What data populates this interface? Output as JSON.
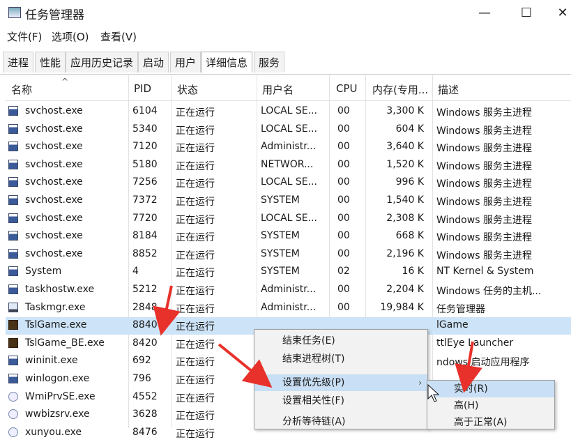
{
  "window": {
    "title": "任务管理器",
    "minimize_glyph": "—",
    "maximize_glyph": "☐",
    "close_glyph": "✕"
  },
  "menu": {
    "file": "文件(F)",
    "options": "选项(O)",
    "view": "查看(V)"
  },
  "tabs": [
    {
      "label": "进程"
    },
    {
      "label": "性能"
    },
    {
      "label": "应用历史记录"
    },
    {
      "label": "启动"
    },
    {
      "label": "用户"
    },
    {
      "label": "详细信息",
      "active": true
    },
    {
      "label": "服务"
    }
  ],
  "columns": {
    "name": "名称",
    "pid": "PID",
    "status": "状态",
    "user": "用户名",
    "cpu": "CPU",
    "memory": "内存(专用...",
    "description": "描述",
    "sort_glyph": "^"
  },
  "rows": [
    {
      "name": "svchost.exe",
      "pid": "6104",
      "status": "正在运行",
      "user": "LOCAL SE...",
      "cpu": "00",
      "mem": "3,300 K",
      "desc": "Windows 服务主进程",
      "icon": "svchost"
    },
    {
      "name": "svchost.exe",
      "pid": "5340",
      "status": "正在运行",
      "user": "LOCAL SE...",
      "cpu": "00",
      "mem": "604 K",
      "desc": "Windows 服务主进程",
      "icon": "svchost"
    },
    {
      "name": "svchost.exe",
      "pid": "7120",
      "status": "正在运行",
      "user": "Administr...",
      "cpu": "00",
      "mem": "3,640 K",
      "desc": "Windows 服务主进程",
      "icon": "svchost"
    },
    {
      "name": "svchost.exe",
      "pid": "5180",
      "status": "正在运行",
      "user": "NETWOR...",
      "cpu": "00",
      "mem": "1,520 K",
      "desc": "Windows 服务主进程",
      "icon": "svchost"
    },
    {
      "name": "svchost.exe",
      "pid": "7256",
      "status": "正在运行",
      "user": "LOCAL SE...",
      "cpu": "00",
      "mem": "996 K",
      "desc": "Windows 服务主进程",
      "icon": "svchost"
    },
    {
      "name": "svchost.exe",
      "pid": "7372",
      "status": "正在运行",
      "user": "SYSTEM",
      "cpu": "00",
      "mem": "1,540 K",
      "desc": "Windows 服务主进程",
      "icon": "svchost"
    },
    {
      "name": "svchost.exe",
      "pid": "7720",
      "status": "正在运行",
      "user": "LOCAL SE...",
      "cpu": "00",
      "mem": "2,308 K",
      "desc": "Windows 服务主进程",
      "icon": "svchost"
    },
    {
      "name": "svchost.exe",
      "pid": "8184",
      "status": "正在运行",
      "user": "SYSTEM",
      "cpu": "00",
      "mem": "668 K",
      "desc": "Windows 服务主进程",
      "icon": "svchost"
    },
    {
      "name": "svchost.exe",
      "pid": "8852",
      "status": "正在运行",
      "user": "SYSTEM",
      "cpu": "00",
      "mem": "2,196 K",
      "desc": "Windows 服务主进程",
      "icon": "svchost"
    },
    {
      "name": "System",
      "pid": "4",
      "status": "正在运行",
      "user": "SYSTEM",
      "cpu": "02",
      "mem": "16 K",
      "desc": "NT Kernel & System",
      "icon": "svchost"
    },
    {
      "name": "taskhostw.exe",
      "pid": "5212",
      "status": "正在运行",
      "user": "Administr...",
      "cpu": "00",
      "mem": "2,204 K",
      "desc": "Windows 任务的主机...",
      "icon": "svchost"
    },
    {
      "name": "Taskmgr.exe",
      "pid": "2848",
      "status": "正在运行",
      "user": "Administr...",
      "cpu": "00",
      "mem": "19,984 K",
      "desc": "任务管理器",
      "icon": "monitor"
    },
    {
      "name": "TslGame.exe",
      "pid": "8840",
      "status": "正在运行",
      "user": "",
      "cpu": "",
      "mem": "",
      "desc": "lGame",
      "icon": "game",
      "selected": true
    },
    {
      "name": "TslGame_BE.exe",
      "pid": "8420",
      "status": "正在运行",
      "user": "",
      "cpu": "",
      "mem": "",
      "desc": "ttlEye Launcher",
      "icon": "game"
    },
    {
      "name": "wininit.exe",
      "pid": "692",
      "status": "正在运行",
      "user": "",
      "cpu": "",
      "mem": "",
      "desc": "ndows 启动应用程序",
      "icon": "svchost"
    },
    {
      "name": "winlogon.exe",
      "pid": "796",
      "status": "正在运行",
      "user": "",
      "cpu": "",
      "mem": "",
      "desc": "",
      "icon": "svchost"
    },
    {
      "name": "WmiPrvSE.exe",
      "pid": "4552",
      "status": "正在运行",
      "user": "",
      "cpu": "",
      "mem": "",
      "desc": "",
      "icon": "gear"
    },
    {
      "name": "wwbizsrv.exe",
      "pid": "3628",
      "status": "正在运行",
      "user": "",
      "cpu": "",
      "mem": "",
      "desc": "",
      "icon": "gear"
    },
    {
      "name": "xunyou.exe",
      "pid": "8476",
      "status": "正在运行",
      "user": "",
      "cpu": "",
      "mem": "",
      "desc": "",
      "icon": "gear"
    }
  ],
  "context_menu": {
    "end_task": "结束任务(E)",
    "end_tree": "结束进程树(T)",
    "set_priority": "设置优先级(P)",
    "set_affinity": "设置相关性(F)",
    "analyze_wait": "分析等待链(A)",
    "submenu_arrow": "›"
  },
  "priority_submenu": {
    "realtime": "实时(R)",
    "high": "高(H)",
    "above_normal": "高于正常(A)"
  },
  "colors": {
    "selection": "#cde3f7",
    "menu_highlight": "#c9dff5",
    "annotation_arrow": "#e8312a"
  }
}
